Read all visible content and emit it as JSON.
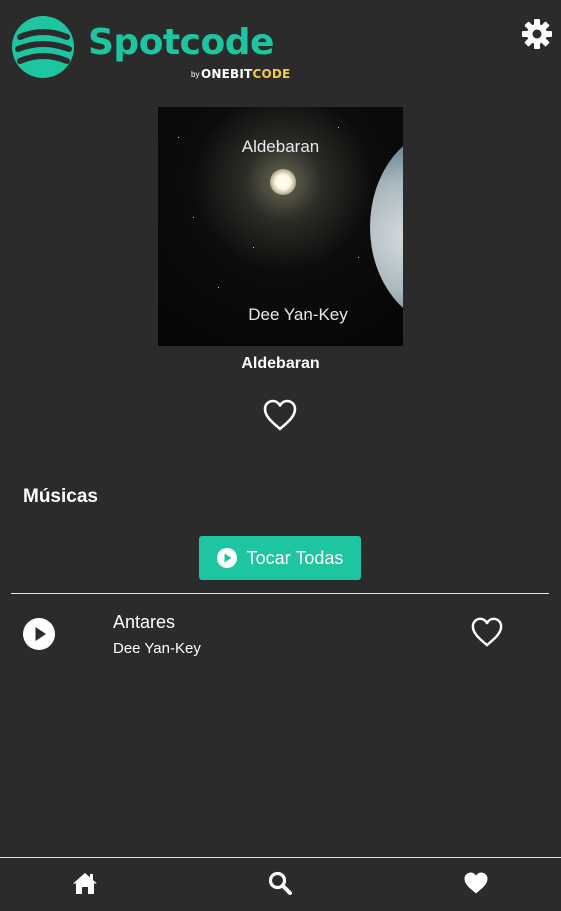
{
  "app": {
    "logo_text": "Spotcode",
    "logo_by": "by",
    "logo_brand_one": "ONEBIT",
    "logo_brand_code": "CODE",
    "brand_color": "#1dc6a1"
  },
  "header": {
    "settings_icon": "gear-icon"
  },
  "album": {
    "cover_title": "Aldebaran",
    "cover_artist": "Dee Yan-Key",
    "title": "Aldebaran",
    "favorite_icon": "heart-outline-icon"
  },
  "section": {
    "title": "Músicas"
  },
  "play_all": {
    "label": "Tocar Todas",
    "icon": "play-circle-icon"
  },
  "tracks": [
    {
      "name": "Antares",
      "artist": "Dee Yan-Key",
      "play_icon": "play-circle-icon",
      "favorite_icon": "heart-outline-icon"
    }
  ],
  "bottom_nav": {
    "items": [
      "home-icon",
      "search-icon",
      "heart-icon"
    ]
  }
}
